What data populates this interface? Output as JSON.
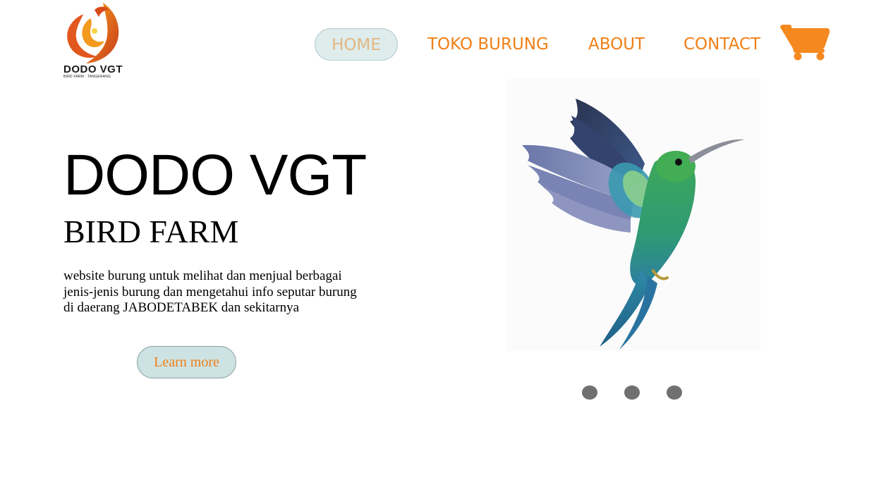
{
  "brand": {
    "logo_title": "DODO VGT",
    "logo_subtitle": "BIRD FARM · TANGERANG"
  },
  "nav": {
    "items": [
      {
        "label": "HOME",
        "active": true
      },
      {
        "label": "TOKO BURUNG",
        "active": false
      },
      {
        "label": "ABOUT",
        "active": false
      },
      {
        "label": "CONTACT",
        "active": false
      }
    ],
    "cart_icon": "shopping-cart-icon"
  },
  "hero": {
    "title": "DODO VGT",
    "subtitle": "BIRD FARM",
    "description": "website burung untuk melihat dan menjual berbagai jenis-jenis burung dan mengetahui info seputar burung di daerang JABODETABEK dan sekitarnya",
    "cta_label": "Learn more",
    "image": "hummingbird-illustration"
  },
  "slider": {
    "dot_count": 3
  },
  "colors": {
    "accent": "#f07f16",
    "active_nav_bg": "#deecec",
    "active_nav_text": "#e2b884",
    "button_bg": "#cde2e2",
    "dot": "#707070"
  }
}
